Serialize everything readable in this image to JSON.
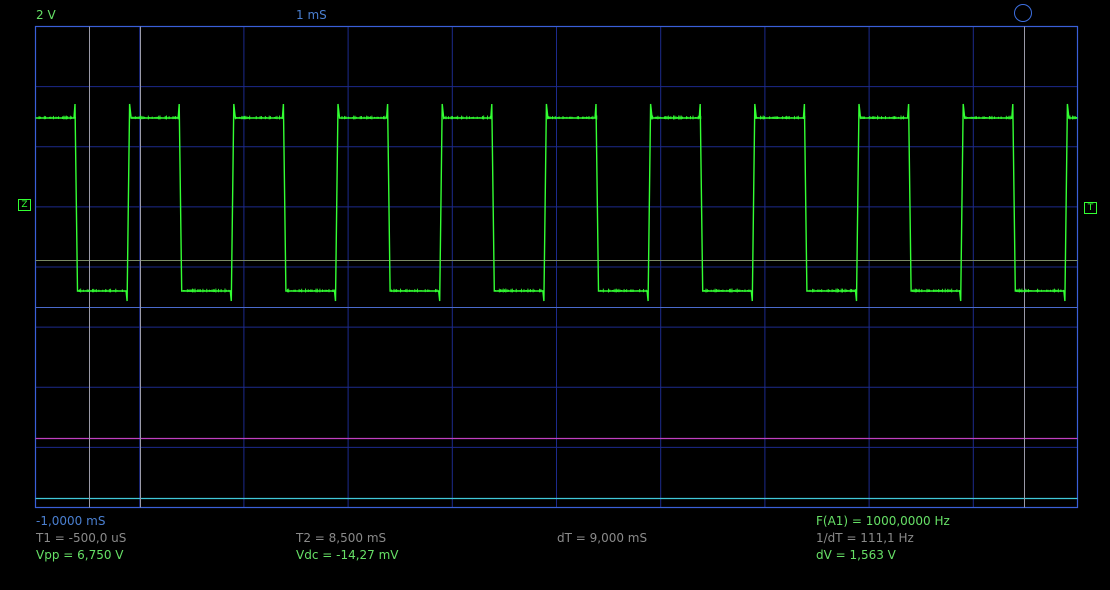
{
  "scope": {
    "volts_per_div": "2 V",
    "time_per_div": "1 mS",
    "start_time": "-1,0000 mS"
  },
  "markers": {
    "zero": "Z",
    "trigger": "T"
  },
  "measurements": {
    "t1": "T1 = -500,0 uS",
    "t2": "T2 = 8,500 mS",
    "dt": "dT = 9,000 mS",
    "frequency": "F(A1) = 1000,0000 Hz",
    "inv_dt": "1/dT = 111,1 Hz",
    "vpp": "Vpp = 6,750 V",
    "vdc": "Vdc = -14,27 mV",
    "dv": "dV = 1,563 V"
  },
  "colors": {
    "background": "#000000",
    "grid": "#1c2a8c",
    "frame": "#3a5fd8",
    "trace": "#33ff33",
    "label_green": "#33ff33",
    "label_blue": "#4a7fd0",
    "label_grey": "#8a8a8a",
    "cursor": "#9a9aa8",
    "level_cursor_a": "#7a8a66",
    "level_cursor_b": "#4a6acc",
    "channel_b": "#c040c0",
    "channel_c": "#40c8d8"
  },
  "icons": {
    "zero_marker": "z-box-icon",
    "trigger_marker": "t-arrow-icon",
    "trigger_knob": "circle-icon"
  }
}
